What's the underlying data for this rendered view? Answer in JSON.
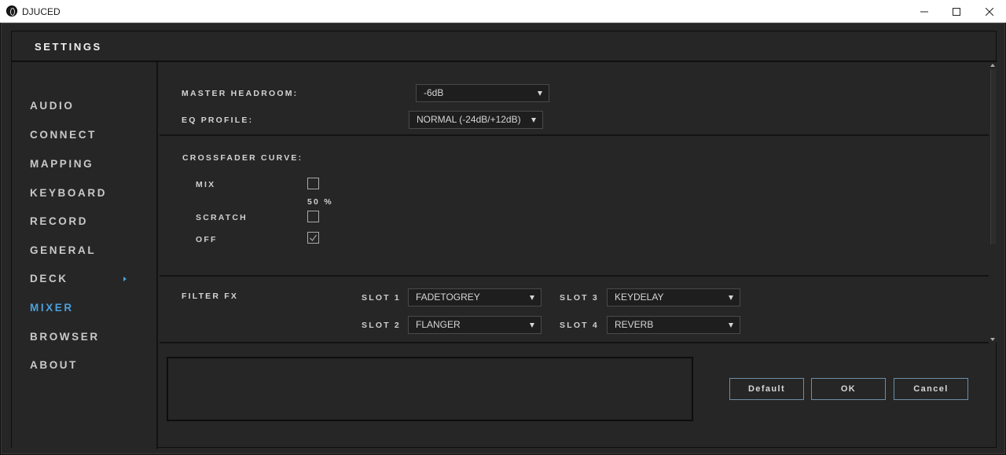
{
  "window": {
    "title": "DJUCED",
    "minimize_icon": "minimize-icon",
    "maximize_icon": "maximize-icon",
    "close_icon": "close-icon"
  },
  "settings_title": "SETTINGS",
  "sidebar": {
    "active": "MIXER",
    "items": [
      {
        "label": "AUDIO"
      },
      {
        "label": "CONNECT"
      },
      {
        "label": "MAPPING"
      },
      {
        "label": "KEYBOARD"
      },
      {
        "label": "RECORD"
      },
      {
        "label": "GENERAL"
      },
      {
        "label": "DECK"
      },
      {
        "label": "MIXER"
      },
      {
        "label": "BROWSER"
      },
      {
        "label": "ABOUT"
      }
    ]
  },
  "mixer": {
    "master_headroom": {
      "label": "MASTER HEADROOM:",
      "value": "-6dB"
    },
    "eq_profile": {
      "label": "EQ PROFILE:",
      "value": "NORMAL (-24dB/+12dB)"
    },
    "crossfader": {
      "label": "CROSSFADER CURVE:",
      "options": [
        {
          "label": "MIX",
          "checked": false
        },
        {
          "label": "SCRATCH",
          "checked": false
        },
        {
          "label": "OFF",
          "checked": true
        }
      ],
      "mix_value": "50 %"
    },
    "filter_fx": {
      "label": "FILTER FX",
      "slots": [
        {
          "label": "SLOT 1",
          "value": "FADETOGREY"
        },
        {
          "label": "SLOT 2",
          "value": "FLANGER"
        },
        {
          "label": "SLOT 3",
          "value": "KEYDELAY"
        },
        {
          "label": "SLOT 4",
          "value": "REVERB"
        }
      ]
    }
  },
  "buttons": {
    "default": "Default",
    "ok": "OK",
    "cancel": "Cancel"
  },
  "colors": {
    "background": "#262626",
    "accent": "#4aa0dc",
    "button_border": "#6b8fa6"
  }
}
